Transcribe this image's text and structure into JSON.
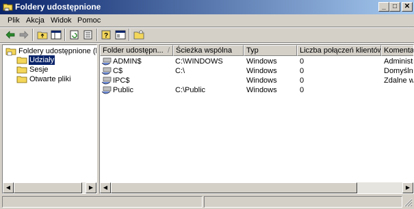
{
  "window": {
    "title": "Foldery udostępnione",
    "minimize_glyph": "_",
    "maximize_glyph": "□",
    "close_glyph": "✕"
  },
  "menu": [
    "Plik",
    "Akcja",
    "Widok",
    "Pomoc"
  ],
  "toolbar": {
    "icons": [
      "back-icon",
      "forward-icon",
      "up-folder-icon",
      "show-hide-tree-icon",
      "refresh-icon",
      "export-list-icon",
      "help-icon",
      "properties-icon",
      "new-share-icon"
    ]
  },
  "tree": {
    "root": "Foldery udostępnione (lokal",
    "items": [
      "Udziały",
      "Sesje",
      "Otwarte pliki"
    ],
    "selected": "Udziały"
  },
  "list": {
    "columns": [
      "Folder udostępn...",
      "Ścieżka wspólna",
      "Typ",
      "Liczba połączeń klientów",
      "Komentar"
    ],
    "sort_indicator": "/",
    "rows": [
      {
        "name": "ADMIN$",
        "path": "C:\\WINDOWS",
        "type": "Windows",
        "connections": "0",
        "comment": "Administr"
      },
      {
        "name": "C$",
        "path": "C:\\",
        "type": "Windows",
        "connections": "0",
        "comment": "Domyślny"
      },
      {
        "name": "IPC$",
        "path": "",
        "type": "Windows",
        "connections": "0",
        "comment": "Zdalne wy"
      },
      {
        "name": "Public",
        "path": "C:\\Public",
        "type": "Windows",
        "connections": "0",
        "comment": ""
      }
    ]
  },
  "colors": {
    "title_start": "#0a246a",
    "title_end": "#a6caf0",
    "face": "#d4d0c8",
    "selection": "#0a246a"
  }
}
